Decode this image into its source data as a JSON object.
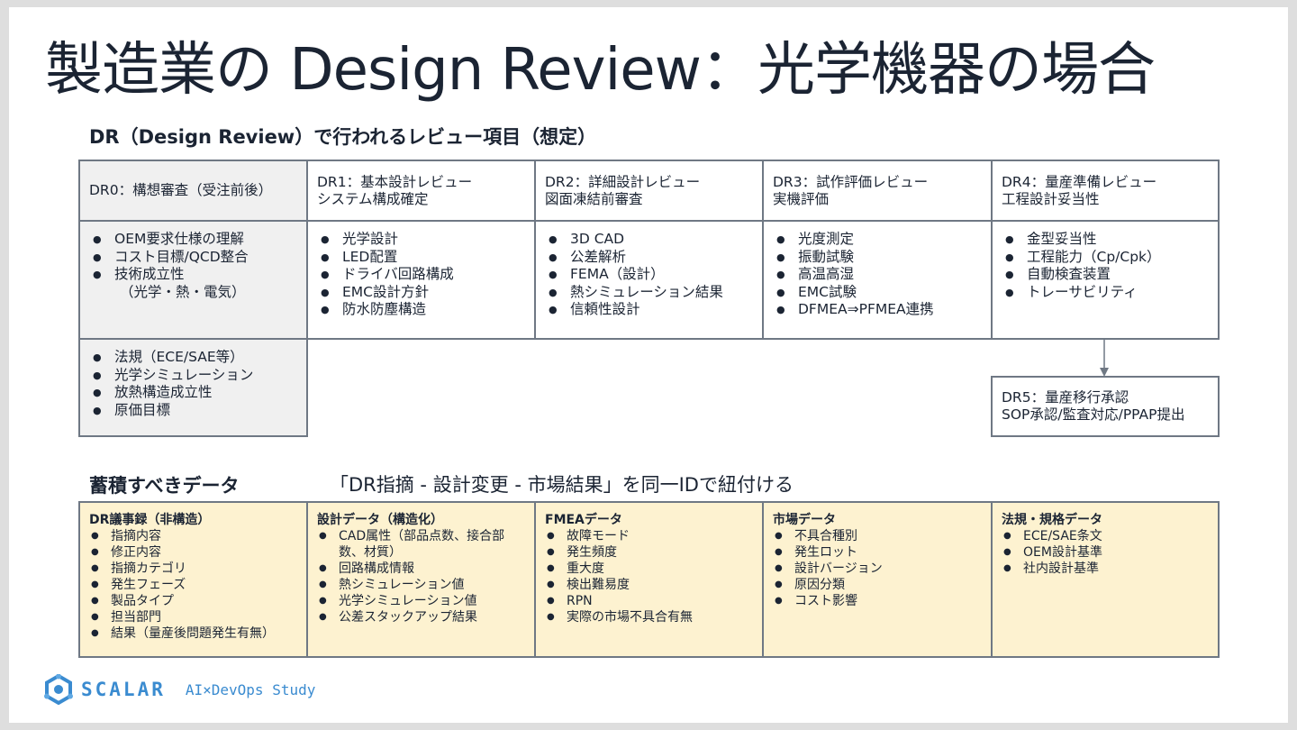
{
  "title": "製造業の Design Review：光学機器の場合",
  "subtitle": "DR（Design Review）で行われるレビュー項目（想定）",
  "dr_stages": [
    {
      "head": [
        "DR0：構想審査（受注前後）"
      ],
      "items": [
        "OEM要求仕様の理解",
        "コスト目標/QCD整合",
        "技術成立性",
        "（光学・熱・電気）"
      ]
    },
    {
      "head": [
        "DR1：基本設計レビュー",
        "システム構成確定"
      ],
      "items": [
        "光学設計",
        "LED配置",
        "ドライバ回路構成",
        "EMC設計方針",
        "防水防塵構造"
      ]
    },
    {
      "head": [
        "DR2：詳細設計レビュー",
        "図面凍結前審査"
      ],
      "items": [
        "3D CAD",
        "公差解析",
        "FEMA（設計）",
        "熱シミュレーション結果",
        "信頼性設計"
      ]
    },
    {
      "head": [
        "DR3：試作評価レビュー",
        "実機評価"
      ],
      "items": [
        "光度測定",
        "振動試験",
        "高温高湿",
        "EMC試験",
        "DFMEA⇒PFMEA連携"
      ]
    },
    {
      "head": [
        "DR4：量産準備レビュー",
        "工程設計妥当性"
      ],
      "items": [
        "金型妥当性",
        "工程能力（Cp/Cpk）",
        "自動検査装置",
        "トレーサビリティ"
      ]
    }
  ],
  "dr0_extra_items": [
    "法規（ECE/SAE等）",
    "光学シミュレーション",
    "放熱構造成立性",
    "原価目標"
  ],
  "dr5": {
    "head": [
      "DR5：量産移行承認",
      "SOP承認/監査対応/PPAP提出"
    ]
  },
  "data_section": {
    "title": "蓄積すべきデータ",
    "note": "「DR指摘 - 設計変更 - 市場結果」を同一IDで紐付ける",
    "categories": [
      {
        "title": "DR議事録（非構造）",
        "items": [
          "指摘内容",
          "修正内容",
          "指摘カテゴリ",
          "発生フェーズ",
          "製品タイプ",
          "担当部門",
          "結果（量産後問題発生有無）"
        ]
      },
      {
        "title": "設計データ（構造化）",
        "items": [
          "CAD属性（部品点数、接合部数、材質）",
          "回路構成情報",
          "熱シミュレーション値",
          "光学シミュレーション値",
          "公差スタックアップ結果"
        ]
      },
      {
        "title": "FMEAデータ",
        "items": [
          "故障モード",
          "発生頻度",
          "重大度",
          "検出難易度",
          "RPN",
          "実際の市場不具合有無"
        ]
      },
      {
        "title": "市場データ",
        "items": [
          "不具合種別",
          "発生ロット",
          "設計バージョン",
          "原因分類",
          "コスト影響"
        ]
      },
      {
        "title": "法規・規格データ",
        "items": [
          "ECE/SAE条文",
          "OEM設計基準",
          "社内設計基準"
        ]
      }
    ]
  },
  "footer": {
    "logo_text": "SCALAR",
    "logo_sub": "AI×DevOps Study",
    "logo_icon": "scalar-logo-icon"
  },
  "colors": {
    "text": "#1b2433",
    "border": "#6f7884",
    "gray_fill": "#f0f0f0",
    "yellow_fill": "#fdf2d0",
    "brand": "#3a8bd0"
  }
}
